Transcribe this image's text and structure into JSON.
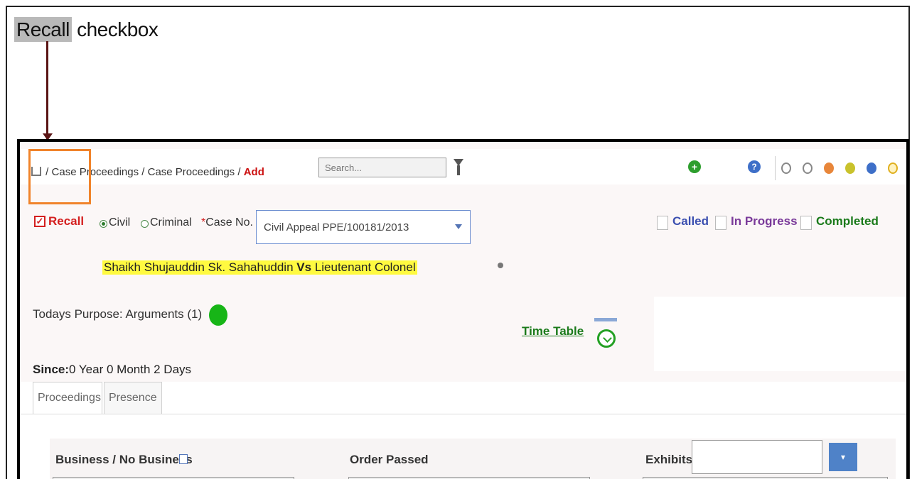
{
  "annotation": {
    "highlight_word": "Recall",
    "rest": " checkbox"
  },
  "breadcrumb": {
    "sep1": " / ",
    "item1": "Case Proceedings",
    "sep2": " / ",
    "item2": "Case Proceedings",
    "sep3": " / ",
    "current": "Add"
  },
  "search": {
    "placeholder": "Search..."
  },
  "toolbar": {
    "plus": "+",
    "help": "?"
  },
  "status_dots": [
    "#ffffff",
    "#ffffff",
    "#e8863a",
    "#c9c22c",
    "#3e6fc8",
    "#f0d040"
  ],
  "form": {
    "recall_label": "Recall",
    "civil_label": "Civil",
    "criminal_label": "Criminal",
    "case_no_req": "*",
    "case_no_label": "Case No.",
    "case_no_value": "Civil Appeal PPE/100181/2013",
    "called": "Called",
    "in_progress": "In Progress",
    "completed": "Completed",
    "party1": "Shaikh Shujauddin Sk. Sahahuddin",
    "vs": "Vs",
    "party2": "Lieutenant Colonel",
    "purpose_label": "Todays Purpose:",
    "purpose_value": "Arguments (1)",
    "time_table": "Time Table",
    "since_label": "Since:",
    "since_value": "0 Year 0 Month 2 Days"
  },
  "tabs": {
    "proceedings": "Proceedings",
    "presence": "Presence"
  },
  "fields": {
    "business": "Business / No Business",
    "order_passed": "Order Passed",
    "exhibits": "Exhibits",
    "exhibits_btn": "▾"
  }
}
